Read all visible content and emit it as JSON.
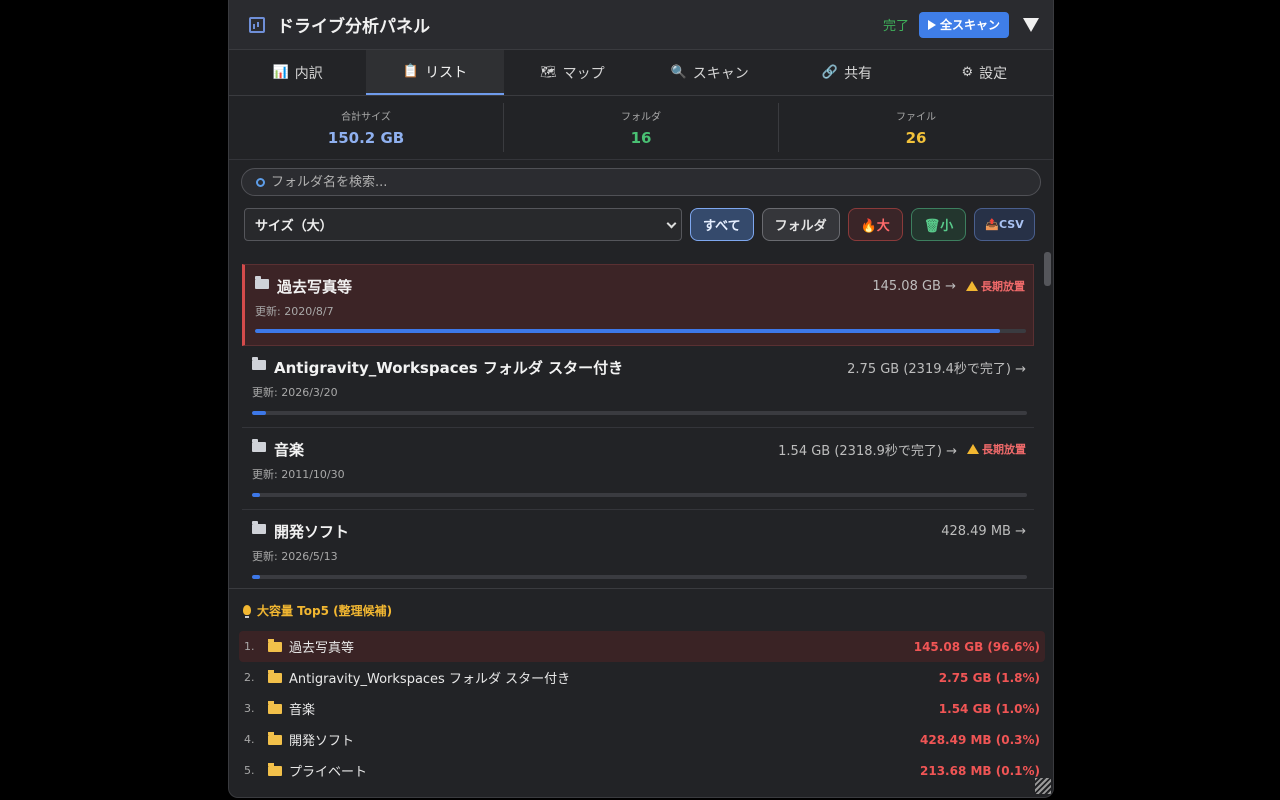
{
  "header": {
    "title": "ドライブ分析パネル",
    "status": "完了",
    "scan_label": "全スキャン"
  },
  "tabs": [
    {
      "icon": "📊",
      "label": "内訳"
    },
    {
      "icon": "📋",
      "label": "リスト"
    },
    {
      "icon": "🗺",
      "label": "マップ"
    },
    {
      "icon": "🔍",
      "label": "スキャン"
    },
    {
      "icon": "🔗",
      "label": "共有"
    },
    {
      "icon": "⚙",
      "label": "設定"
    }
  ],
  "stats": [
    {
      "label": "合計サイズ",
      "value": "150.2 GB",
      "color": "#8fb0ef"
    },
    {
      "label": "フォルダ",
      "value": "16",
      "color": "#49c073"
    },
    {
      "label": "ファイル",
      "value": "26",
      "color": "#f2c23a"
    }
  ],
  "search": {
    "placeholder": "フォルダ名を検索..."
  },
  "toolbar": {
    "sort_value": "サイズ（大）",
    "all_label": "すべて",
    "folder_label": "フォルダ",
    "large_label": "🔥大",
    "small_label": "🗑小",
    "csv_label": "📤CSV"
  },
  "list": [
    {
      "name": "過去写真等",
      "size": "145.08 GB →",
      "warn": "長期放置",
      "updated": "更新: 2020/8/7",
      "fill_pct": 96.6
    },
    {
      "name": "Antigravity_Workspaces フォルダ スター付き",
      "size": "2.75 GB (2319.4秒で完了) →",
      "warn": "",
      "updated": "更新: 2026/3/20",
      "fill_pct": 1.8
    },
    {
      "name": "音楽",
      "size": "1.54 GB (2318.9秒で完了) →",
      "warn": "長期放置",
      "updated": "更新: 2011/10/30",
      "fill_pct": 1.0
    },
    {
      "name": "開発ソフト",
      "size": "428.49 MB →",
      "warn": "",
      "updated": "更新: 2026/5/13",
      "fill_pct": 0.3
    }
  ],
  "top5": {
    "title": "大容量 Top5 (整理候補)",
    "items": [
      {
        "rank": "1.",
        "name": "過去写真等",
        "size": "145.08 GB (96.6%)"
      },
      {
        "rank": "2.",
        "name": "Antigravity_Workspaces フォルダ スター付き",
        "size": "2.75 GB (1.8%)"
      },
      {
        "rank": "3.",
        "name": "音楽",
        "size": "1.54 GB (1.0%)"
      },
      {
        "rank": "4.",
        "name": "開発ソフト",
        "size": "428.49 MB (0.3%)"
      },
      {
        "rank": "5.",
        "name": "プライベート",
        "size": "213.68 MB (0.1%)"
      }
    ]
  }
}
